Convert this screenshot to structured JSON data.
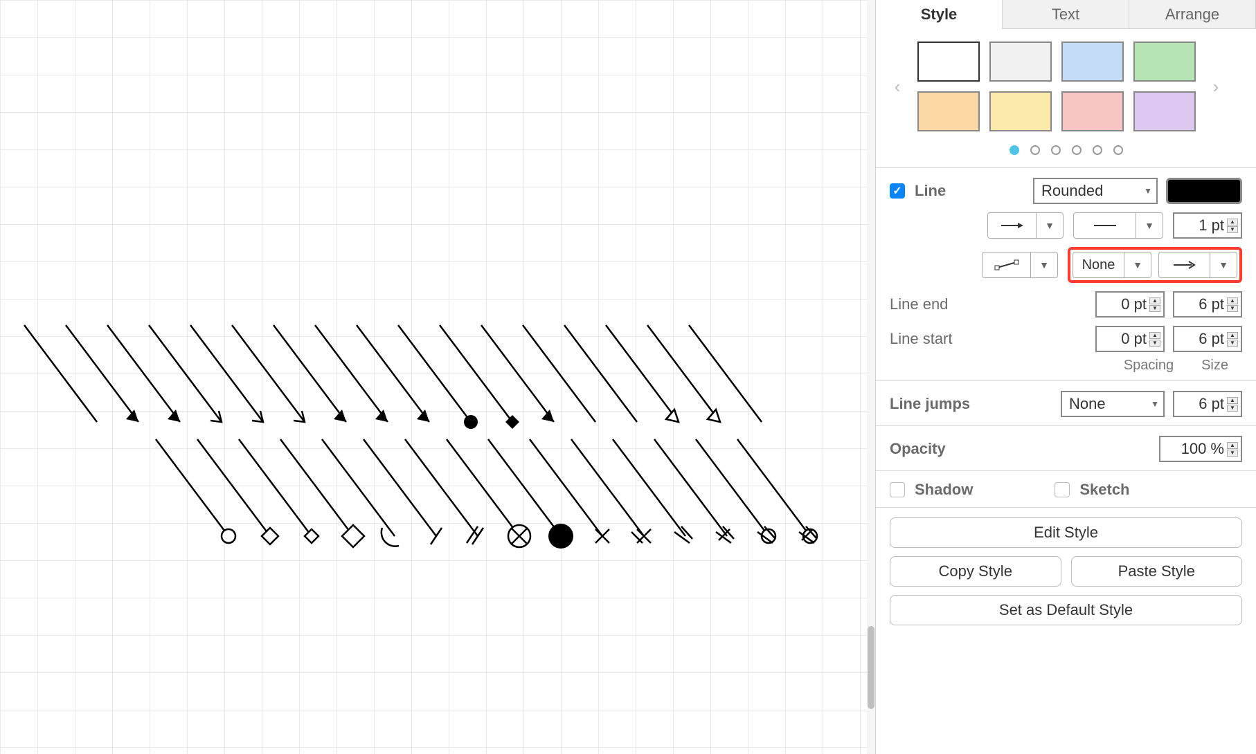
{
  "tabs": {
    "style": "Style",
    "text": "Text",
    "arrange": "Arrange"
  },
  "palette": {
    "colors": [
      "#ffffff",
      "#f0f0f0",
      "#c5dcf9",
      "#b7e4b4",
      "#fbd7a5",
      "#fbeaa9",
      "#f7c6c4",
      "#dcc8ef"
    ]
  },
  "line": {
    "label": "Line",
    "style_select": "Rounded",
    "thickness": "1 pt",
    "endpoint_left": "None",
    "line_end_label": "Line end",
    "line_start_label": "Line start",
    "line_end_spacing": "0 pt",
    "line_end_size": "6 pt",
    "line_start_spacing": "0 pt",
    "line_start_size": "6 pt",
    "spacing_label": "Spacing",
    "size_label": "Size"
  },
  "line_jumps": {
    "label": "Line jumps",
    "select": "None",
    "size": "6 pt"
  },
  "opacity": {
    "label": "Opacity",
    "value": "100 %"
  },
  "shadow_label": "Shadow",
  "sketch_label": "Sketch",
  "buttons": {
    "edit_style": "Edit Style",
    "copy_style": "Copy Style",
    "paste_style": "Paste Style",
    "set_default": "Set as Default Style"
  }
}
